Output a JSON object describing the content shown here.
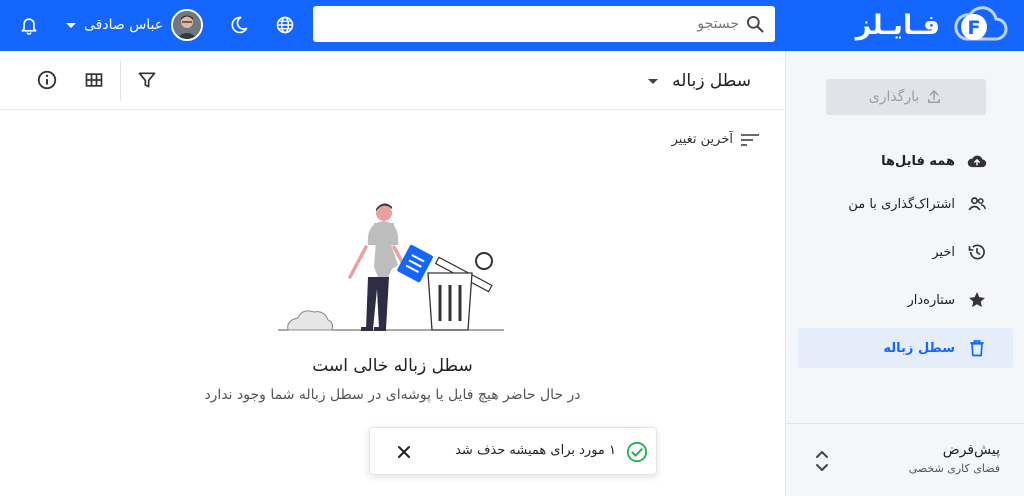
{
  "app": {
    "brand_name": "فـایـلز",
    "brand_color": "#1565ff"
  },
  "topbar": {
    "search_placeholder": "جستجو",
    "user_name": "عباس صادقی",
    "icons": [
      "search-icon",
      "globe-icon",
      "moon-icon",
      "bell-icon"
    ]
  },
  "sidebar": {
    "upload_label": "بارگذاری",
    "items": [
      {
        "label": "همه فایل‌ها",
        "icon": "cloud-upload-icon"
      },
      {
        "label": "اشتراک‌گذاری با من",
        "icon": "people-icon"
      },
      {
        "label": "اخیر",
        "icon": "history-icon"
      },
      {
        "label": "ستاره‌دار",
        "icon": "star-icon"
      },
      {
        "label": "سطل زباله",
        "icon": "trash-icon",
        "active": true
      }
    ],
    "workspace_title": "پیش‌فرض",
    "workspace_sub": "فضای کاری شخصی"
  },
  "main": {
    "title": "سطل زباله",
    "sort_label": "آخرین تغییر",
    "empty_title": "سطل زباله خالی است",
    "empty_sub": "در حال حاضر هیچ فایل یا پوشه‌ای در سطل زباله شما وجود ندارد"
  },
  "toast": {
    "message": "۱ مورد برای همیشه حذف شد",
    "status_color": "#22b14c"
  }
}
